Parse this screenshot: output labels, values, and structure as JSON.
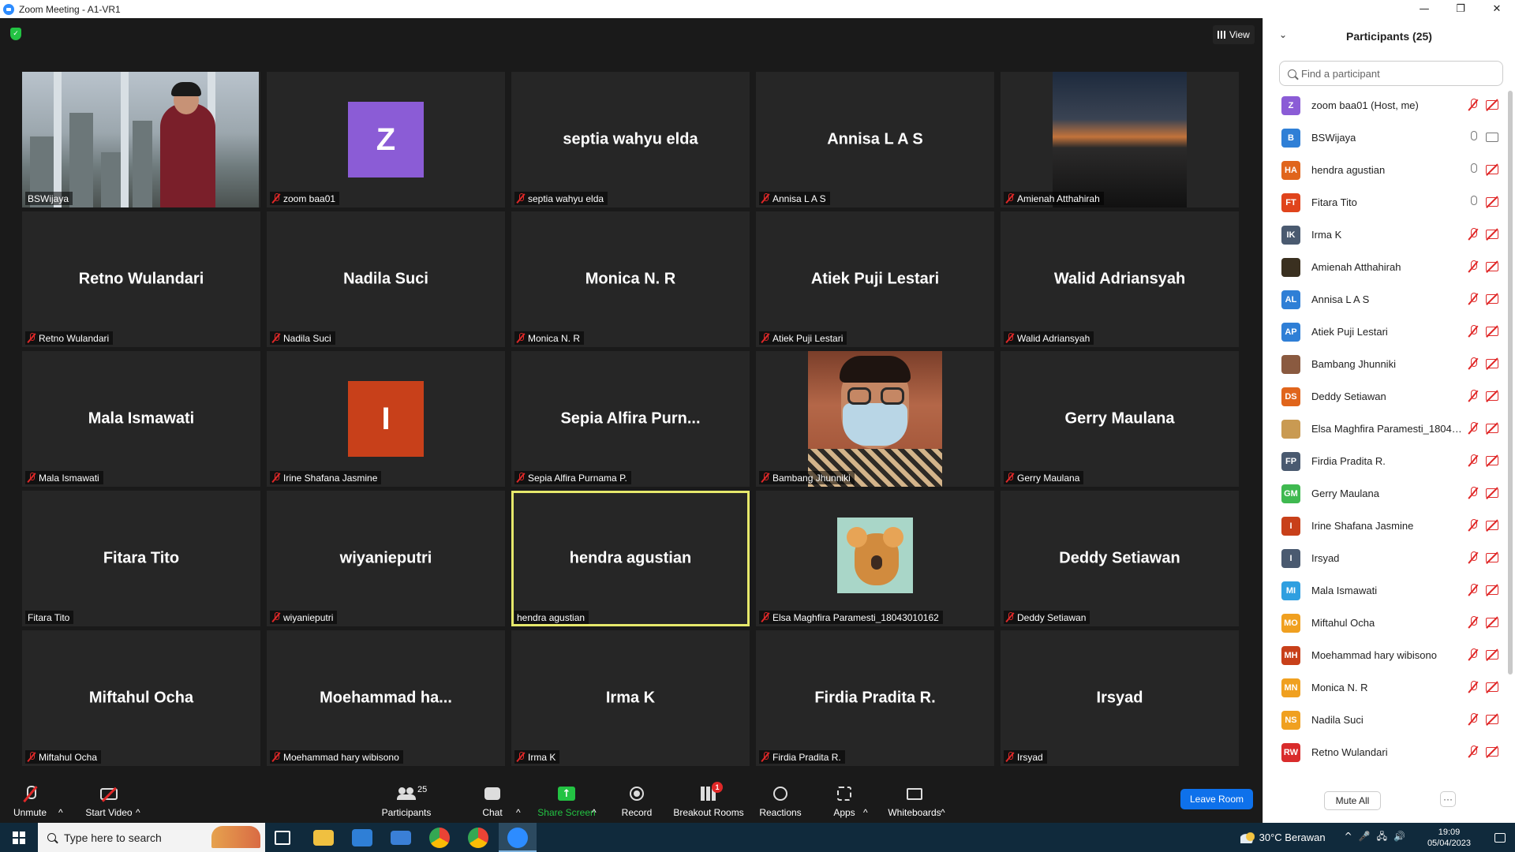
{
  "window": {
    "title": "Zoom Meeting - A1-VR1",
    "controls": [
      "—",
      "❐",
      "✕"
    ]
  },
  "meeting": {
    "view_label": "View",
    "tiles": [
      {
        "name": "BSWijaya",
        "big": "",
        "muted": false,
        "video": "city"
      },
      {
        "name": "zoom baa01",
        "big": "",
        "muted": true,
        "avatar_letter": "Z",
        "avatar_color": "#8b5cd6"
      },
      {
        "name": "septia wahyu elda",
        "big": "septia wahyu elda",
        "muted": true
      },
      {
        "name": "Annisa L A S",
        "big": "Annisa L A S",
        "muted": true
      },
      {
        "name": "Amienah Atthahirah",
        "big": "",
        "muted": true,
        "video": "sunset"
      },
      {
        "name": "Retno Wulandari",
        "big": "Retno Wulandari",
        "muted": true
      },
      {
        "name": "Nadila Suci",
        "big": "Nadila Suci",
        "muted": true
      },
      {
        "name": "Monica N. R",
        "big": "Monica N. R",
        "muted": true
      },
      {
        "name": "Atiek Puji Lestari",
        "big": "Atiek Puji Lestari",
        "muted": true
      },
      {
        "name": "Walid Adriansyah",
        "big": "Walid Adriansyah",
        "muted": true
      },
      {
        "name": "Mala Ismawati",
        "big": "Mala Ismawati",
        "muted": true
      },
      {
        "name": "Irine Shafana Jasmine",
        "big": "",
        "muted": true,
        "avatar_letter": "I",
        "avatar_color": "#c8401a"
      },
      {
        "name": "Sepia Alfira Purnama P.",
        "big": "Sepia  Alfira  Purn...",
        "muted": true
      },
      {
        "name": "Bambang Jhunniki",
        "big": "",
        "muted": true,
        "video": "mask"
      },
      {
        "name": "Gerry Maulana",
        "big": "Gerry Maulana",
        "muted": true
      },
      {
        "name": "Fitara Tito",
        "big": "Fitara Tito",
        "muted": false
      },
      {
        "name": "wiyanieputri",
        "big": "wiyanieputri",
        "muted": true
      },
      {
        "name": "hendra agustian",
        "big": "hendra agustian",
        "muted": false,
        "speaking": true
      },
      {
        "name": "Elsa Maghfira Paramesti_18043010162",
        "big": "",
        "muted": true,
        "video": "koala"
      },
      {
        "name": "Deddy Setiawan",
        "big": "Deddy Setiawan",
        "muted": true
      },
      {
        "name": "Miftahul Ocha",
        "big": "Miftahul Ocha",
        "muted": true
      },
      {
        "name": "Moehammad hary wibisono",
        "big": "Moehammad  ha...",
        "muted": true
      },
      {
        "name": "Irma K",
        "big": "Irma K",
        "muted": true
      },
      {
        "name": "Firdia Pradita R.",
        "big": "Firdia Pradita R.",
        "muted": true
      },
      {
        "name": "Irsyad",
        "big": "Irsyad",
        "muted": true
      }
    ]
  },
  "toolbar": {
    "unmute": "Unmute",
    "start_video": "Start Video",
    "participants": "Participants",
    "participants_count": "25",
    "chat": "Chat",
    "share_screen": "Share Screen",
    "record": "Record",
    "breakout_rooms": "Breakout Rooms",
    "breakout_badge": "1",
    "reactions": "Reactions",
    "apps": "Apps",
    "whiteboards": "Whiteboards",
    "leave": "Leave Room"
  },
  "panel": {
    "title": "Participants (25)",
    "search_placeholder": "Find a participant",
    "mute_all": "Mute All",
    "more": "···",
    "participants": [
      {
        "initials": "Z",
        "color": "#8b5cd6",
        "name": "zoom baa01 (Host, me)",
        "mic": "muted",
        "cam": "off"
      },
      {
        "initials": "B",
        "color": "#2f7fd6",
        "name": "BSWijaya",
        "mic": "on",
        "cam": "on"
      },
      {
        "initials": "HA",
        "color": "#e0651c",
        "name": "hendra agustian",
        "mic": "on",
        "cam": "off"
      },
      {
        "initials": "FT",
        "color": "#e0441c",
        "name": "Fitara Tito",
        "mic": "on",
        "cam": "off"
      },
      {
        "initials": "IK",
        "color": "#4a5a70",
        "name": "Irma K",
        "mic": "muted",
        "cam": "off"
      },
      {
        "initials": "",
        "color": "#3a3020",
        "name": "Amienah Atthahirah",
        "mic": "muted",
        "cam": "off"
      },
      {
        "initials": "AL",
        "color": "#2f7fd6",
        "name": "Annisa L A S",
        "mic": "muted",
        "cam": "off"
      },
      {
        "initials": "AP",
        "color": "#2f7fd6",
        "name": "Atiek Puji Lestari",
        "mic": "muted",
        "cam": "off"
      },
      {
        "initials": "",
        "color": "#8a5a40",
        "name": "Bambang Jhunniki",
        "mic": "muted",
        "cam": "off"
      },
      {
        "initials": "DS",
        "color": "#e0651c",
        "name": "Deddy Setiawan",
        "mic": "muted",
        "cam": "off"
      },
      {
        "initials": "",
        "color": "#c99a52",
        "name": "Elsa Maghfira Paramesti_18043...",
        "mic": "muted",
        "cam": "off"
      },
      {
        "initials": "FP",
        "color": "#4a5a70",
        "name": "Firdia Pradita R.",
        "mic": "muted",
        "cam": "off"
      },
      {
        "initials": "GM",
        "color": "#3fb950",
        "name": "Gerry Maulana",
        "mic": "muted",
        "cam": "off"
      },
      {
        "initials": "I",
        "color": "#c8401a",
        "name": "Irine Shafana Jasmine",
        "mic": "muted",
        "cam": "off"
      },
      {
        "initials": "I",
        "color": "#4a5a70",
        "name": "Irsyad",
        "mic": "muted",
        "cam": "off"
      },
      {
        "initials": "MI",
        "color": "#2f9fe0",
        "name": "Mala Ismawati",
        "mic": "muted",
        "cam": "off"
      },
      {
        "initials": "MO",
        "color": "#f0a020",
        "name": "Miftahul Ocha",
        "mic": "muted",
        "cam": "off"
      },
      {
        "initials": "MH",
        "color": "#c8401a",
        "name": "Moehammad hary wibisono",
        "mic": "muted",
        "cam": "off"
      },
      {
        "initials": "MN",
        "color": "#f0a020",
        "name": "Monica N. R",
        "mic": "muted",
        "cam": "off"
      },
      {
        "initials": "NS",
        "color": "#f0a020",
        "name": "Nadila Suci",
        "mic": "muted",
        "cam": "off"
      },
      {
        "initials": "RW",
        "color": "#d92c2c",
        "name": "Retno Wulandari",
        "mic": "muted",
        "cam": "off"
      }
    ]
  },
  "taskbar": {
    "search_placeholder": "Type here to search",
    "weather": "30°C  Berawan",
    "time": "19:09",
    "date": "05/04/2023"
  }
}
